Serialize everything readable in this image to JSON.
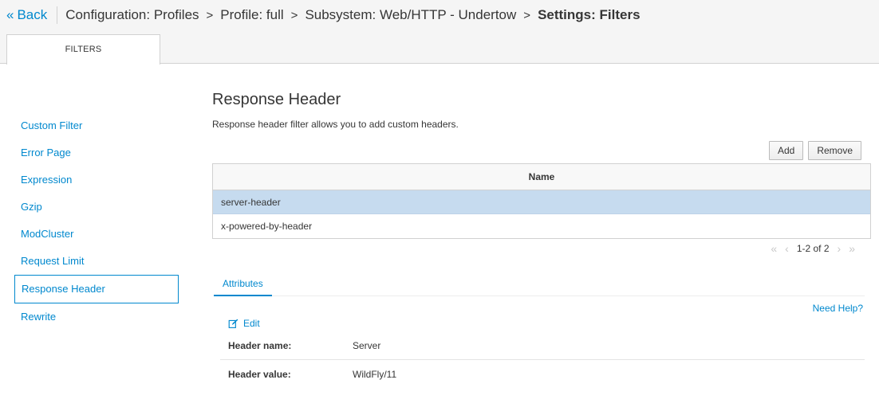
{
  "header": {
    "back_label": "Back",
    "breadcrumbs": [
      "Configuration: Profiles",
      "Profile: full",
      "Subsystem: Web/HTTP - Undertow",
      "Settings: Filters"
    ]
  },
  "top_tab": {
    "label": "FILTERS"
  },
  "sidebar": {
    "items": [
      {
        "label": "Custom Filter"
      },
      {
        "label": "Error Page"
      },
      {
        "label": "Expression"
      },
      {
        "label": "Gzip"
      },
      {
        "label": "ModCluster"
      },
      {
        "label": "Request Limit"
      },
      {
        "label": "Response Header"
      },
      {
        "label": "Rewrite"
      }
    ],
    "active_index": 6
  },
  "main": {
    "title": "Response Header",
    "description": "Response header filter allows you to add custom headers.",
    "add_label": "Add",
    "remove_label": "Remove",
    "table": {
      "column": "Name",
      "rows": [
        "server-header",
        "x-powered-by-header"
      ],
      "selected_index": 0
    },
    "pager": {
      "first_icon": "double-chevron-left-icon",
      "prev_icon": "chevron-left-icon",
      "status": "1-2 of 2",
      "next_icon": "chevron-right-icon",
      "last_icon": "double-chevron-right-icon"
    },
    "tabs": [
      {
        "label": "Attributes"
      }
    ],
    "help_label": "Need Help?",
    "edit_label": "Edit",
    "attributes": [
      {
        "key": "Header name:",
        "value": "Server"
      },
      {
        "key": "Header value:",
        "value": "WildFly/11"
      }
    ]
  },
  "colors": {
    "link": "#0088ce",
    "selected_row": "#c6dbef",
    "text": "#363636"
  }
}
